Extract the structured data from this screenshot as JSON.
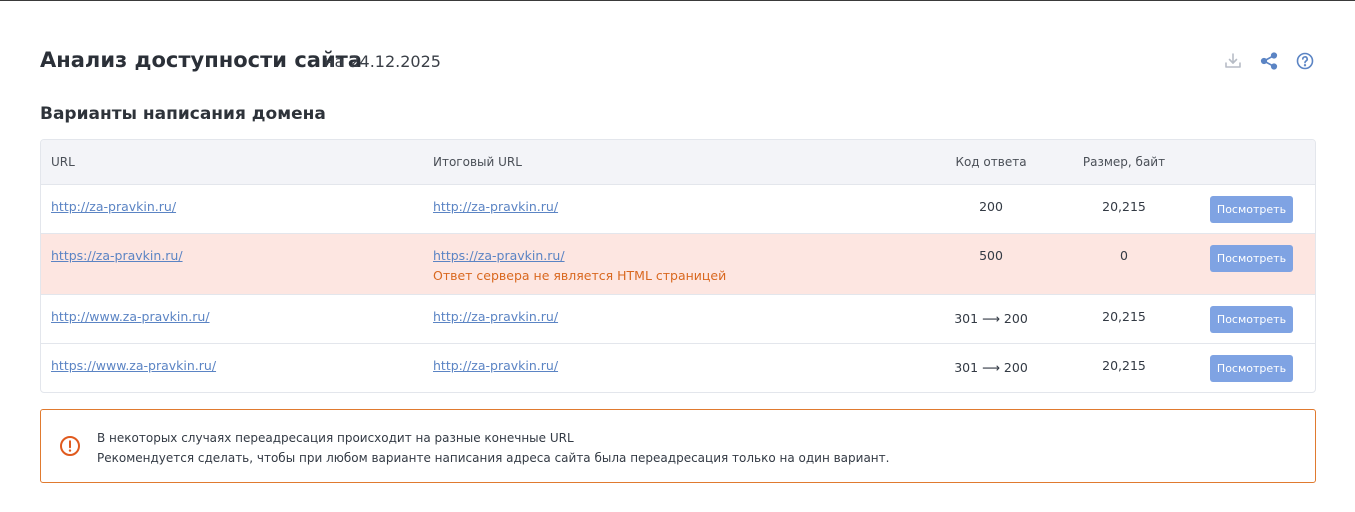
{
  "header": {
    "title": "Анализ доступности сайта",
    "date": "на 24.12.2025"
  },
  "section": {
    "title": "Варианты написания домена"
  },
  "table": {
    "columns": [
      "URL",
      "Итоговый URL",
      "Код ответа",
      "Размер, байт"
    ],
    "button_label": "Посмотреть",
    "rows": [
      {
        "url": "http://za-pravkin.ru/",
        "final_url": "http://za-pravkin.ru/",
        "code": "200",
        "size": "20,215",
        "error": ""
      },
      {
        "url": "https://za-pravkin.ru/",
        "final_url": "https://za-pravkin.ru/",
        "code": "500",
        "size": "0",
        "error": "Ответ сервера не является HTML страницей"
      },
      {
        "url": "http://www.za-pravkin.ru/",
        "final_url": "http://za-pravkin.ru/",
        "code": "301 ⟶ 200",
        "size": "20,215",
        "error": ""
      },
      {
        "url": "https://www.za-pravkin.ru/",
        "final_url": "http://za-pravkin.ru/",
        "code": "301 ⟶ 200",
        "size": "20,215",
        "error": ""
      }
    ]
  },
  "alert": {
    "line1": "В некоторых случаях переадресация происходит на разные конечные URL",
    "line2": "Рекомендуется сделать, чтобы при любом варианте написания адреса сайта была переадресация только на один вариант."
  },
  "icons": {
    "download": "download-icon",
    "share": "share-icon",
    "help": "help-icon",
    "warning": "warning-icon"
  },
  "colors": {
    "link": "#5b84c4",
    "button": "#7fa3e3",
    "error_row": "#fde6e1",
    "error_text": "#d9681f",
    "alert_border": "#e07a2f"
  }
}
